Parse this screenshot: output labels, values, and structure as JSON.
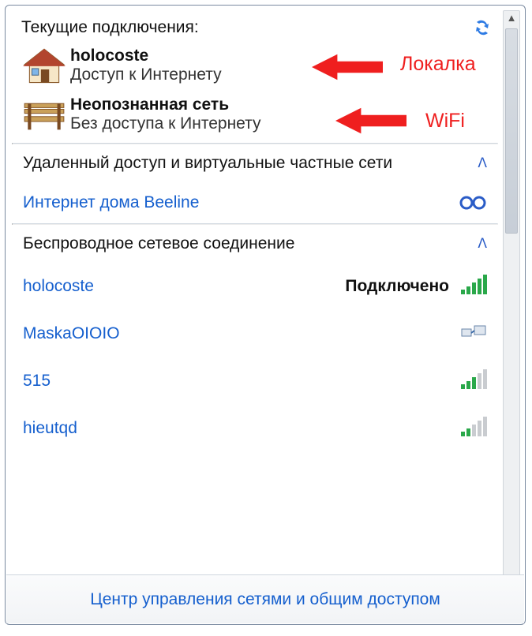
{
  "header": {
    "title": "Текущие подключения:"
  },
  "connections": [
    {
      "name": "holocoste",
      "status": "Доступ к Интернету",
      "annot": "Локалка",
      "icon": "house"
    },
    {
      "name": "Неопознанная сеть",
      "status": "Без доступа к Интернету",
      "annot": "WiFi",
      "icon": "bench"
    }
  ],
  "sections": {
    "vpn": {
      "title": "Удаленный доступ и виртуальные частные сети",
      "items": [
        {
          "name": "Интернет дома Beeline"
        }
      ]
    },
    "wireless": {
      "title": "Беспроводное сетевое соединение",
      "items": [
        {
          "name": "holocoste",
          "state": "Подключено",
          "signal": 5,
          "color": "green"
        },
        {
          "name": "MaskaOIOIO",
          "state": "",
          "signal": 0,
          "color": "blue"
        },
        {
          "name": "515",
          "state": "",
          "signal": 3,
          "color": "green"
        },
        {
          "name": "hieutqd",
          "state": "",
          "signal": 2,
          "color": "green"
        }
      ]
    }
  },
  "footer": {
    "link": "Центр управления сетями и общим доступом"
  }
}
